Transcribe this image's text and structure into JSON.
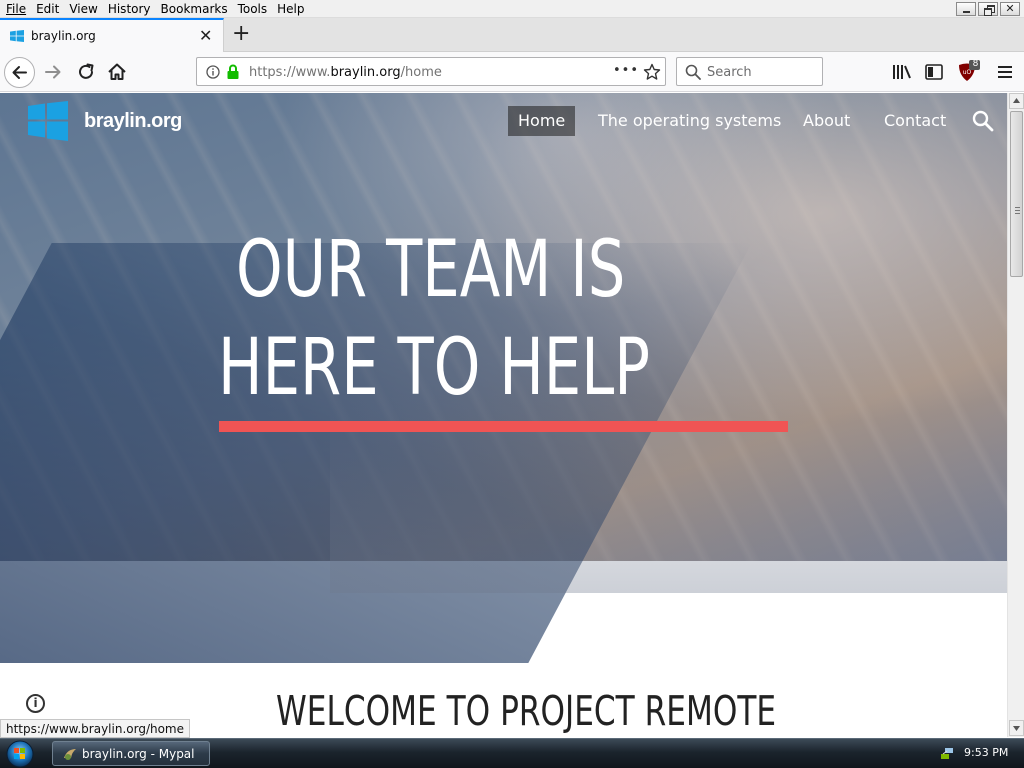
{
  "menubar": {
    "items": [
      "File",
      "Edit",
      "View",
      "History",
      "Bookmarks",
      "Tools",
      "Help"
    ]
  },
  "tab": {
    "title": "braylin.org",
    "close_glyph": "✕",
    "new_tab_glyph": "+"
  },
  "urlbar": {
    "url_prefix": "https://www.",
    "url_domain": "braylin.org",
    "url_path": "/home",
    "page_actions_glyph": "•••"
  },
  "searchbar": {
    "placeholder": "Search"
  },
  "toolbar": {
    "ublock_badge": "8"
  },
  "site": {
    "name": "braylin.org",
    "nav": [
      {
        "label": "Home",
        "active": true
      },
      {
        "label": "The operating systems",
        "active": false
      },
      {
        "label": "About",
        "active": false
      },
      {
        "label": "Contact",
        "active": false
      }
    ],
    "hero_line1": "OUR TEAM IS",
    "hero_line2": "HERE TO HELP",
    "welcome_heading": "WELCOME TO PROJECT REMOTE",
    "info_glyph": "i",
    "accent_color": "#f05454",
    "logo_color": "#1ba1e2"
  },
  "status": {
    "link_url": "https://www.braylin.org/home"
  },
  "taskbar": {
    "window_label": "braylin.org - Mypal",
    "clock": "9:53 PM"
  }
}
